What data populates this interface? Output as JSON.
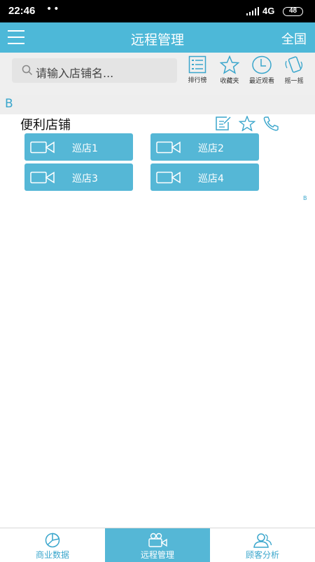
{
  "status_bar": {
    "time": "22:46",
    "dots": "••",
    "network": "4G",
    "battery": "48"
  },
  "header": {
    "title": "远程管理",
    "region": "全国",
    "menu_icon": "hamburger-menu-icon"
  },
  "search": {
    "placeholder": "请输入店铺名..."
  },
  "toolbar": {
    "items": [
      {
        "label": "排行榜",
        "icon": "ranking-list-icon"
      },
      {
        "label": "收藏夹",
        "icon": "star-icon"
      },
      {
        "label": "最近观看",
        "icon": "clock-icon"
      },
      {
        "label": "摇一摇",
        "icon": "shake-phone-icon"
      }
    ]
  },
  "section_letter": "B",
  "store": {
    "name": "便利店铺",
    "actions": [
      "edit-icon",
      "star-outline-icon",
      "phone-icon"
    ],
    "cameras": [
      {
        "label": "巡店1"
      },
      {
        "label": "巡店2"
      },
      {
        "label": "巡店3"
      },
      {
        "label": "巡店4"
      }
    ]
  },
  "index_letter": "B",
  "bottom_nav": {
    "tabs": [
      {
        "label": "商业数据",
        "icon": "pie-chart-icon",
        "active": false
      },
      {
        "label": "远程管理",
        "icon": "video-camera-icon",
        "active": true
      },
      {
        "label": "顾客分析",
        "icon": "users-icon",
        "active": false
      }
    ]
  },
  "colors": {
    "accent": "#4db8d8",
    "button": "#55b7d6",
    "letter": "#3aa6cc"
  }
}
